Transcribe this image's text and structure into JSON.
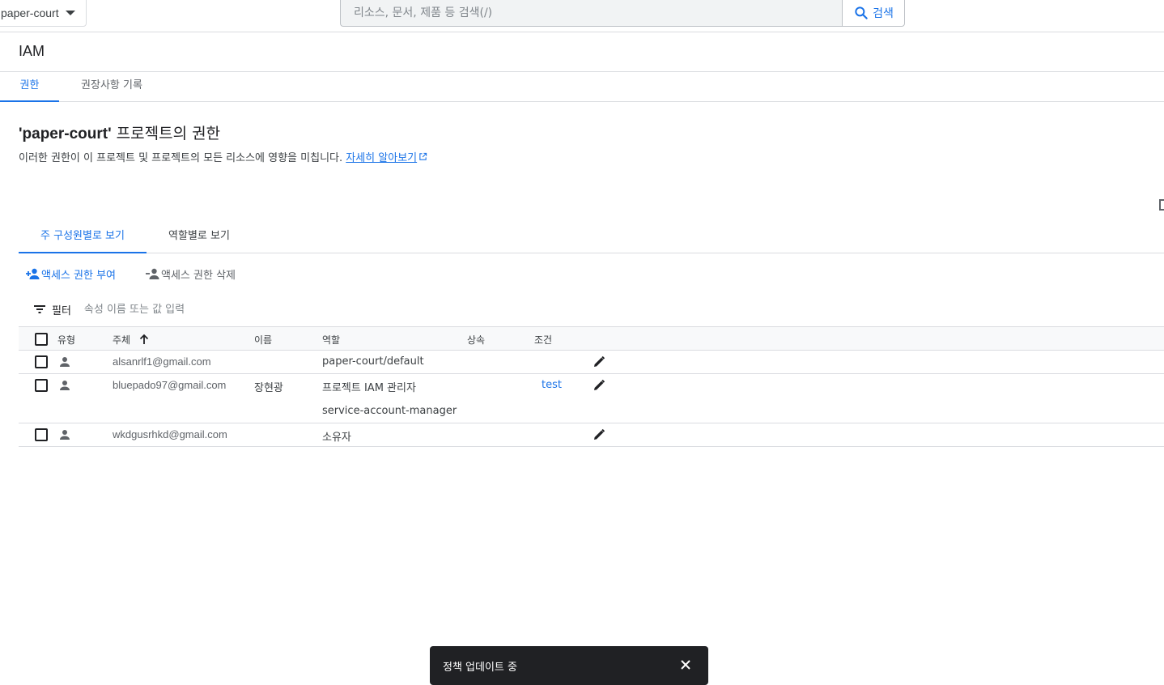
{
  "topbar": {
    "project": "paper-court",
    "search_placeholder": "리소스, 문서, 제품 등 검색(/)",
    "search_button": "검색"
  },
  "page": {
    "title": "IAM"
  },
  "main_tabs": [
    {
      "label": "권한",
      "active": true
    },
    {
      "label": "권장사항 기록",
      "active": false
    }
  ],
  "section": {
    "title_project": "'paper-court'",
    "title_suffix": " 프로젝트의 권한",
    "description": "이러한 권한이 이 프로젝트 및 프로젝트의 모든 리소스에 영향을 미칩니다. ",
    "learn_more": "자세히 알아보기"
  },
  "view_tabs": [
    {
      "label": "주 구성원별로 보기",
      "active": true
    },
    {
      "label": "역할별로 보기",
      "active": false
    }
  ],
  "actions": {
    "grant": "액세스 권한 부여",
    "remove": "액세스 권한 삭제"
  },
  "filter": {
    "label": "필터",
    "placeholder": "속성 이름 또는 값 입력"
  },
  "table": {
    "columns": {
      "type": "유형",
      "principal": "주체",
      "name": "이름",
      "role": "역할",
      "inheritance": "상속",
      "condition": "조건"
    },
    "rows": [
      {
        "principal": "alsanrlf1@gmail.com",
        "name": "",
        "roles": [
          "paper-court/default"
        ],
        "condition": ""
      },
      {
        "principal": "bluepado97@gmail.com",
        "name": "장현광",
        "roles": [
          "프로젝트 IAM 관리자",
          "service-account-manager"
        ],
        "condition": "test"
      },
      {
        "principal": "wkdgusrhkd@gmail.com",
        "name": "",
        "roles": [
          "소유자"
        ],
        "condition": ""
      }
    ]
  },
  "snackbar": {
    "message": "정책 업데이트 중"
  },
  "colors": {
    "accent": "#1a73e8",
    "snackbar_bg": "#202124"
  }
}
